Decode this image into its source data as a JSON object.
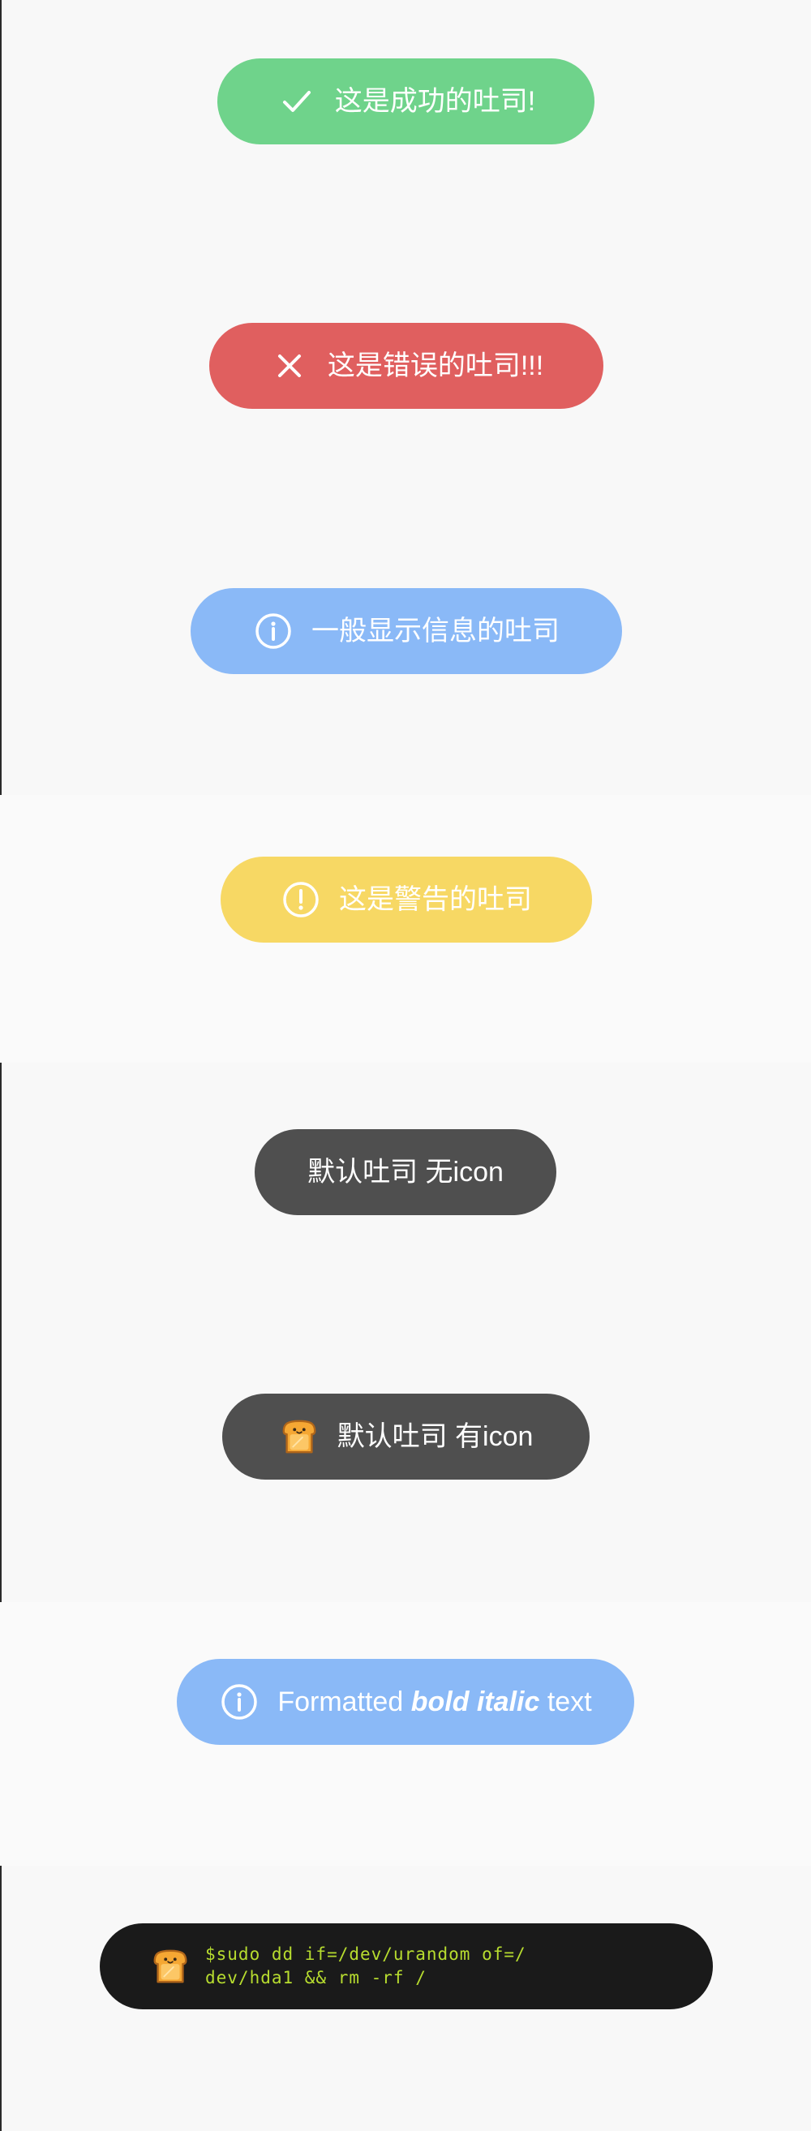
{
  "toasts": {
    "success": {
      "text": "这是成功的吐司!",
      "icon": "check-icon",
      "color": "#6fd38b"
    },
    "error": {
      "text": "这是错误的吐司!!!",
      "icon": "close-icon",
      "color": "#e05f5f"
    },
    "info": {
      "text": "一般显示信息的吐司",
      "icon": "info-icon",
      "color": "#8ab9f7"
    },
    "warning": {
      "text": "这是警告的吐司",
      "icon": "exclamation-icon",
      "color": "#f7d864"
    },
    "default_no_icon": {
      "text": "默认吐司 无icon",
      "color": "#4f4f4f"
    },
    "default_with_icon": {
      "text": "默认吐司 有icon",
      "icon": "toast-bread-icon",
      "color": "#4f4f4f"
    },
    "formatted": {
      "prefix": "Formatted",
      "emphasis": "bold italic",
      "suffix": "text",
      "icon": "info-icon",
      "color": "#8ab9f7"
    },
    "custom_terminal": {
      "line1": "$sudo dd if=/dev/urandom of=/",
      "line2": "dev/hda1 && rm -rf /",
      "icon": "toast-bread-icon",
      "background": "#1a1a1a",
      "text_color": "#b7dc2f"
    }
  }
}
